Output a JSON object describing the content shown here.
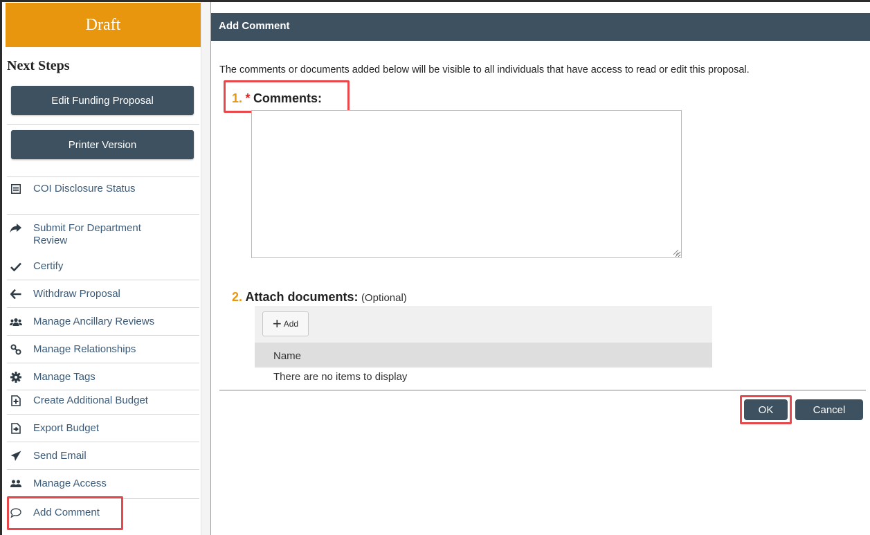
{
  "sidebar": {
    "status": "Draft",
    "heading": "Next Steps",
    "buttons": [
      "Edit Funding Proposal",
      "Printer Version"
    ],
    "actions": [
      {
        "label": "COI Disclosure Status",
        "icon": "list-icon"
      },
      {
        "label": "Submit For Department Review",
        "icon": "share-arrow-icon"
      },
      {
        "label": "Certify",
        "icon": "checkmark-icon"
      },
      {
        "label": "Withdraw Proposal",
        "icon": "arrow-left-icon"
      },
      {
        "label": "Manage Ancillary Reviews",
        "icon": "users-group-icon"
      },
      {
        "label": "Manage Relationships",
        "icon": "link-icon"
      },
      {
        "label": "Manage Tags",
        "icon": "gear-icon"
      },
      {
        "label": "Create Additional Budget",
        "icon": "add-document-icon"
      },
      {
        "label": "Export Budget",
        "icon": "export-document-icon"
      },
      {
        "label": "Send Email",
        "icon": "paper-plane-icon"
      },
      {
        "label": "Manage Access",
        "icon": "users-icon"
      },
      {
        "label": "Add Comment",
        "icon": "comment-icon"
      }
    ]
  },
  "dialog": {
    "title": "Add Comment",
    "intro": "The comments or documents added below will be visible to all individuals that have access to read or edit this proposal.",
    "q1": {
      "number": "1.",
      "required_marker": "*",
      "label": "Comments:",
      "value": ""
    },
    "q2": {
      "number": "2.",
      "label": "Attach documents:",
      "optional": "(Optional)"
    },
    "attach": {
      "add_label": "Add",
      "column_name": "Name",
      "empty_message": "There are no items to display"
    },
    "ok_label": "OK",
    "cancel_label": "Cancel"
  },
  "colors": {
    "status_banner": "#e8960e",
    "button_bg": "#3e5160",
    "highlight": "#e8474b",
    "question_number": "#e8960e",
    "required": "#e02020",
    "link": "#3a5a78"
  }
}
